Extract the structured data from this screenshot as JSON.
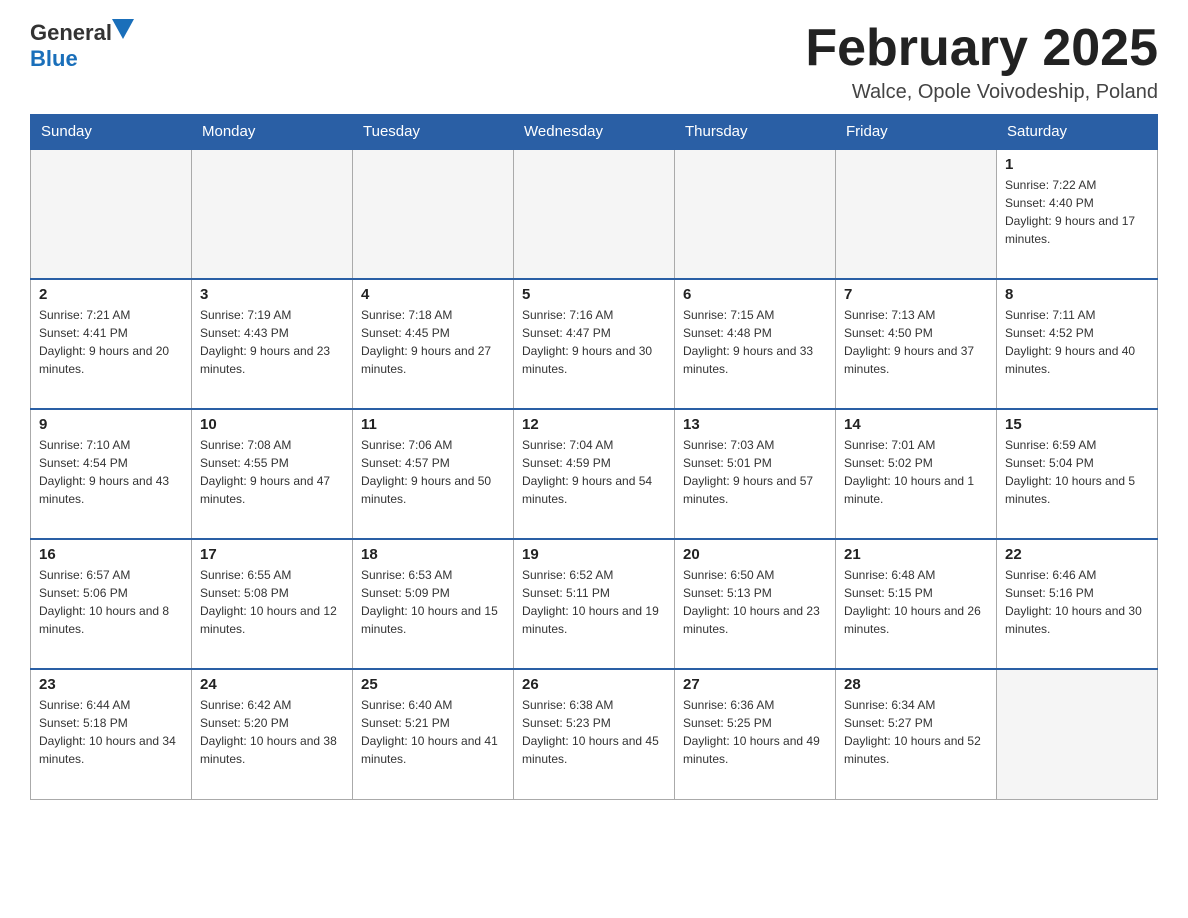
{
  "header": {
    "logo_general": "General",
    "logo_blue": "Blue",
    "month_title": "February 2025",
    "location": "Walce, Opole Voivodeship, Poland"
  },
  "days_of_week": [
    "Sunday",
    "Monday",
    "Tuesday",
    "Wednesday",
    "Thursday",
    "Friday",
    "Saturday"
  ],
  "weeks": [
    [
      {
        "day": "",
        "info": ""
      },
      {
        "day": "",
        "info": ""
      },
      {
        "day": "",
        "info": ""
      },
      {
        "day": "",
        "info": ""
      },
      {
        "day": "",
        "info": ""
      },
      {
        "day": "",
        "info": ""
      },
      {
        "day": "1",
        "info": "Sunrise: 7:22 AM\nSunset: 4:40 PM\nDaylight: 9 hours and 17 minutes."
      }
    ],
    [
      {
        "day": "2",
        "info": "Sunrise: 7:21 AM\nSunset: 4:41 PM\nDaylight: 9 hours and 20 minutes."
      },
      {
        "day": "3",
        "info": "Sunrise: 7:19 AM\nSunset: 4:43 PM\nDaylight: 9 hours and 23 minutes."
      },
      {
        "day": "4",
        "info": "Sunrise: 7:18 AM\nSunset: 4:45 PM\nDaylight: 9 hours and 27 minutes."
      },
      {
        "day": "5",
        "info": "Sunrise: 7:16 AM\nSunset: 4:47 PM\nDaylight: 9 hours and 30 minutes."
      },
      {
        "day": "6",
        "info": "Sunrise: 7:15 AM\nSunset: 4:48 PM\nDaylight: 9 hours and 33 minutes."
      },
      {
        "day": "7",
        "info": "Sunrise: 7:13 AM\nSunset: 4:50 PM\nDaylight: 9 hours and 37 minutes."
      },
      {
        "day": "8",
        "info": "Sunrise: 7:11 AM\nSunset: 4:52 PM\nDaylight: 9 hours and 40 minutes."
      }
    ],
    [
      {
        "day": "9",
        "info": "Sunrise: 7:10 AM\nSunset: 4:54 PM\nDaylight: 9 hours and 43 minutes."
      },
      {
        "day": "10",
        "info": "Sunrise: 7:08 AM\nSunset: 4:55 PM\nDaylight: 9 hours and 47 minutes."
      },
      {
        "day": "11",
        "info": "Sunrise: 7:06 AM\nSunset: 4:57 PM\nDaylight: 9 hours and 50 minutes."
      },
      {
        "day": "12",
        "info": "Sunrise: 7:04 AM\nSunset: 4:59 PM\nDaylight: 9 hours and 54 minutes."
      },
      {
        "day": "13",
        "info": "Sunrise: 7:03 AM\nSunset: 5:01 PM\nDaylight: 9 hours and 57 minutes."
      },
      {
        "day": "14",
        "info": "Sunrise: 7:01 AM\nSunset: 5:02 PM\nDaylight: 10 hours and 1 minute."
      },
      {
        "day": "15",
        "info": "Sunrise: 6:59 AM\nSunset: 5:04 PM\nDaylight: 10 hours and 5 minutes."
      }
    ],
    [
      {
        "day": "16",
        "info": "Sunrise: 6:57 AM\nSunset: 5:06 PM\nDaylight: 10 hours and 8 minutes."
      },
      {
        "day": "17",
        "info": "Sunrise: 6:55 AM\nSunset: 5:08 PM\nDaylight: 10 hours and 12 minutes."
      },
      {
        "day": "18",
        "info": "Sunrise: 6:53 AM\nSunset: 5:09 PM\nDaylight: 10 hours and 15 minutes."
      },
      {
        "day": "19",
        "info": "Sunrise: 6:52 AM\nSunset: 5:11 PM\nDaylight: 10 hours and 19 minutes."
      },
      {
        "day": "20",
        "info": "Sunrise: 6:50 AM\nSunset: 5:13 PM\nDaylight: 10 hours and 23 minutes."
      },
      {
        "day": "21",
        "info": "Sunrise: 6:48 AM\nSunset: 5:15 PM\nDaylight: 10 hours and 26 minutes."
      },
      {
        "day": "22",
        "info": "Sunrise: 6:46 AM\nSunset: 5:16 PM\nDaylight: 10 hours and 30 minutes."
      }
    ],
    [
      {
        "day": "23",
        "info": "Sunrise: 6:44 AM\nSunset: 5:18 PM\nDaylight: 10 hours and 34 minutes."
      },
      {
        "day": "24",
        "info": "Sunrise: 6:42 AM\nSunset: 5:20 PM\nDaylight: 10 hours and 38 minutes."
      },
      {
        "day": "25",
        "info": "Sunrise: 6:40 AM\nSunset: 5:21 PM\nDaylight: 10 hours and 41 minutes."
      },
      {
        "day": "26",
        "info": "Sunrise: 6:38 AM\nSunset: 5:23 PM\nDaylight: 10 hours and 45 minutes."
      },
      {
        "day": "27",
        "info": "Sunrise: 6:36 AM\nSunset: 5:25 PM\nDaylight: 10 hours and 49 minutes."
      },
      {
        "day": "28",
        "info": "Sunrise: 6:34 AM\nSunset: 5:27 PM\nDaylight: 10 hours and 52 minutes."
      },
      {
        "day": "",
        "info": ""
      }
    ]
  ]
}
